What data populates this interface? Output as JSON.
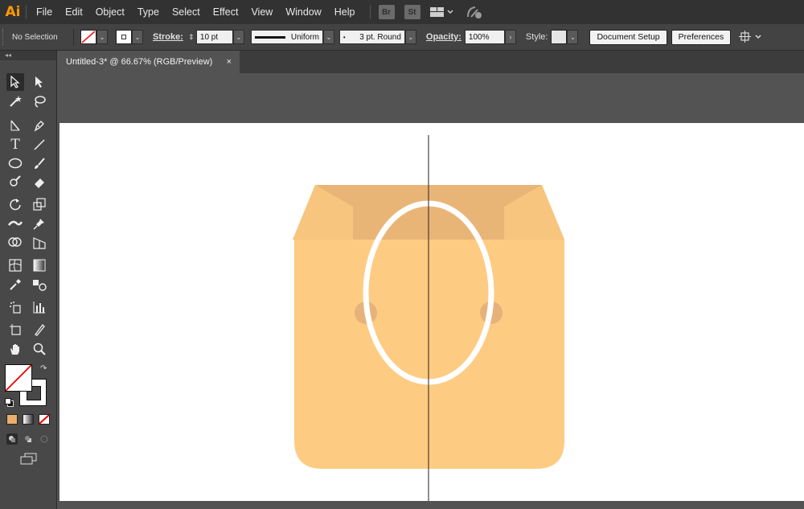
{
  "app": {
    "logo": "Ai"
  },
  "menu": {
    "items": [
      "File",
      "Edit",
      "Object",
      "Type",
      "Select",
      "Effect",
      "View",
      "Window",
      "Help"
    ],
    "bridge_label": "Br",
    "stock_label": "St"
  },
  "control": {
    "selection_label": "No Selection",
    "stroke_label": "Stroke:",
    "stroke_weight": "10 pt",
    "stroke_profile": "Uniform",
    "brush_definition": "3 pt. Round",
    "opacity_label": "Opacity:",
    "opacity_value": "100%",
    "style_label": "Style:",
    "document_setup": "Document Setup",
    "preferences": "Preferences"
  },
  "document": {
    "tab_title": "Untitled-3* @ 66.67% (RGB/Preview)",
    "close_glyph": "×"
  },
  "toolbox": {
    "collapse_glyph": "◂◂"
  },
  "colors": {
    "bag_body": "#fecb83",
    "bag_fold": "#f4c07a",
    "bag_inner": "#e9b577",
    "bag_hole": "#e6b27a",
    "ellipse_stroke": "#ffffff",
    "fill_swatch": "#e8b06c",
    "ui_accent": "#ff9a00"
  }
}
